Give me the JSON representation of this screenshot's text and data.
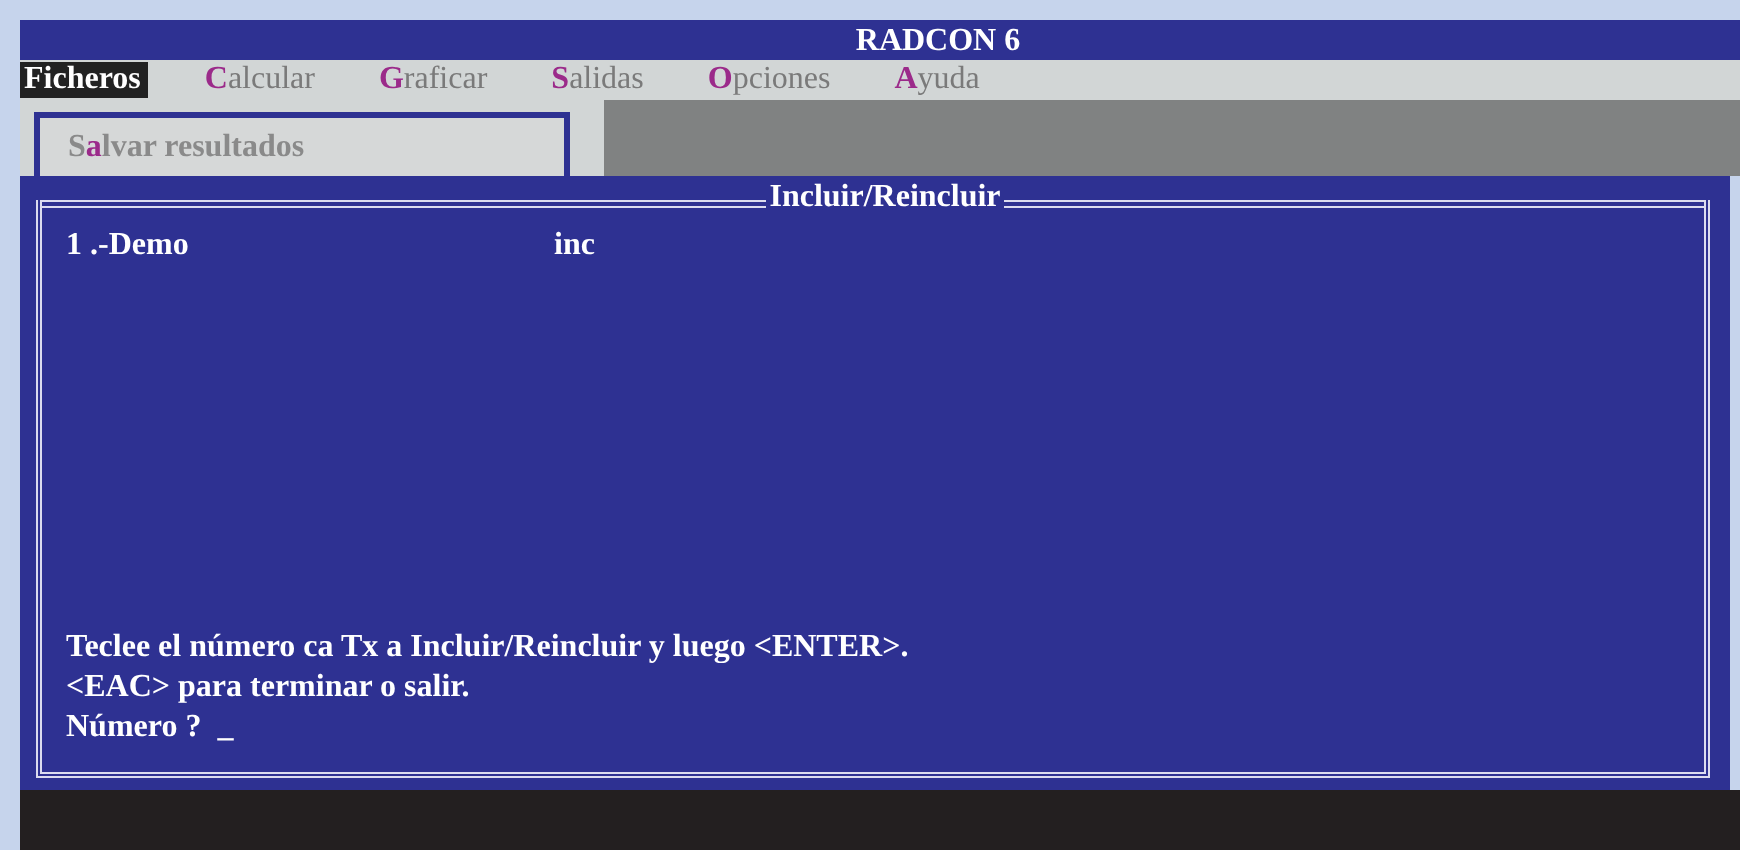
{
  "window": {
    "title": "RADCON 6"
  },
  "menu": [
    {
      "key": "F",
      "after": "icheros",
      "selected": true
    },
    {
      "key": "C",
      "after": "alcular",
      "selected": false
    },
    {
      "key": "G",
      "after": "raficar",
      "selected": false
    },
    {
      "key": "S",
      "after": "alidas",
      "selected": false
    },
    {
      "key": "O",
      "after": "pciones",
      "selected": false
    },
    {
      "key": "A",
      "after": "yuda",
      "selected": false
    }
  ],
  "submenu": [
    {
      "before": "S",
      "key": "a",
      "after": "lvar resultados"
    }
  ],
  "dialog": {
    "title": "Incluir/Reincluir",
    "rows": [
      {
        "number": "1 .-Demo",
        "status": "inc"
      }
    ],
    "messages": [
      "Teclee el número ca Tx a Incluir/Reincluir y luego <ENTER>.",
      "<EAC> para terminar o salir."
    ],
    "prompt": {
      "label": "Número ?",
      "cursor": "_"
    }
  }
}
